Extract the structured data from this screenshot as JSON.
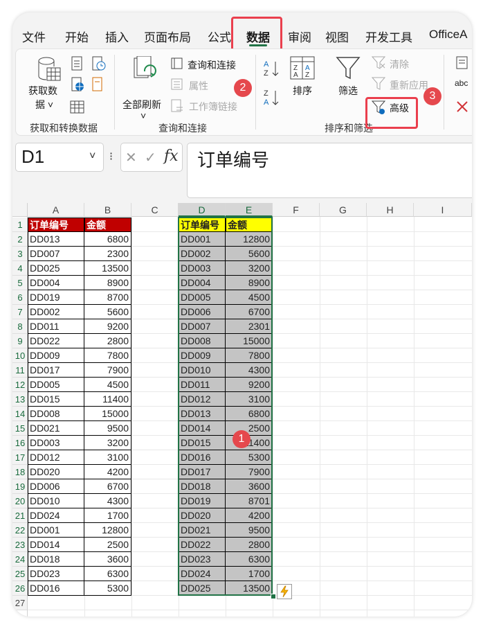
{
  "tabs": [
    "文件",
    "开始",
    "插入",
    "页面布局",
    "公式",
    "数据",
    "审阅",
    "视图",
    "开发工具",
    "OfficeA"
  ],
  "active_tab": "数据",
  "ribbon": {
    "get_data": {
      "label_1": "获取数",
      "label_2": "据 ˅"
    },
    "refresh_all": {
      "label": "全部刷新",
      "arrow": "˅"
    },
    "queries_connections": "查询和连接",
    "properties": "属性",
    "workbook_links": "工作簿链接",
    "sort": "排序",
    "filter": "筛选",
    "clear": "清除",
    "reapply": "重新应用",
    "advanced": "高级",
    "text_to_columns_partial": "abc",
    "groups": {
      "get_transform": "获取和转换数据",
      "queries": "查询和连接",
      "sort_filter": "排序和筛选"
    }
  },
  "annotations": {
    "badge_1": "1",
    "badge_2": "2",
    "badge_3": "3"
  },
  "formula_bar": {
    "name_box": "D1",
    "dropdown": "˅",
    "fx": "fx",
    "cancel": "✕",
    "confirm": "✓",
    "formula": "订单编号"
  },
  "columns": [
    "A",
    "B",
    "C",
    "D",
    "E",
    "F",
    "G",
    "H",
    "I"
  ],
  "rows": [
    "1",
    "2",
    "3",
    "4",
    "5",
    "6",
    "7",
    "8",
    "9",
    "10",
    "11",
    "12",
    "13",
    "14",
    "15",
    "16",
    "17",
    "18",
    "19",
    "20",
    "21",
    "22",
    "23",
    "24",
    "25",
    "26",
    "27"
  ],
  "colors": {
    "header_red": "#c00000",
    "header_yellow": "#ffff00",
    "selection_gray": "#c4c4c4",
    "excel_green": "#217346",
    "badge_red": "#e5484d",
    "highlight_red": "#ea3f4d"
  },
  "table_left": {
    "headers": [
      "订单编号",
      "金额"
    ],
    "rows": [
      [
        "DD013",
        "6800"
      ],
      [
        "DD007",
        "2300"
      ],
      [
        "DD025",
        "13500"
      ],
      [
        "DD004",
        "8900"
      ],
      [
        "DD019",
        "8700"
      ],
      [
        "DD002",
        "5600"
      ],
      [
        "DD011",
        "9200"
      ],
      [
        "DD022",
        "2800"
      ],
      [
        "DD009",
        "7800"
      ],
      [
        "DD017",
        "7900"
      ],
      [
        "DD005",
        "4500"
      ],
      [
        "DD015",
        "11400"
      ],
      [
        "DD008",
        "15000"
      ],
      [
        "DD021",
        "9500"
      ],
      [
        "DD003",
        "3200"
      ],
      [
        "DD012",
        "3100"
      ],
      [
        "DD020",
        "4200"
      ],
      [
        "DD006",
        "6700"
      ],
      [
        "DD010",
        "4300"
      ],
      [
        "DD024",
        "1700"
      ],
      [
        "DD001",
        "12800"
      ],
      [
        "DD014",
        "2500"
      ],
      [
        "DD018",
        "3600"
      ],
      [
        "DD023",
        "6300"
      ],
      [
        "DD016",
        "5300"
      ]
    ]
  },
  "table_right": {
    "headers": [
      "订单编号",
      "金额"
    ],
    "rows": [
      [
        "DD001",
        "12800"
      ],
      [
        "DD002",
        "5600"
      ],
      [
        "DD003",
        "3200"
      ],
      [
        "DD004",
        "8900"
      ],
      [
        "DD005",
        "4500"
      ],
      [
        "DD006",
        "6700"
      ],
      [
        "DD007",
        "2301"
      ],
      [
        "DD008",
        "15000"
      ],
      [
        "DD009",
        "7800"
      ],
      [
        "DD010",
        "4300"
      ],
      [
        "DD011",
        "9200"
      ],
      [
        "DD012",
        "3100"
      ],
      [
        "DD013",
        "6800"
      ],
      [
        "DD014",
        "2500"
      ],
      [
        "DD015",
        "11400"
      ],
      [
        "DD016",
        "5300"
      ],
      [
        "DD017",
        "7900"
      ],
      [
        "DD018",
        "3600"
      ],
      [
        "DD019",
        "8701"
      ],
      [
        "DD020",
        "4200"
      ],
      [
        "DD021",
        "9500"
      ],
      [
        "DD022",
        "2800"
      ],
      [
        "DD023",
        "6300"
      ],
      [
        "DD024",
        "1700"
      ],
      [
        "DD025",
        "13500"
      ]
    ]
  },
  "quick_analysis_icon": "lightning-icon"
}
